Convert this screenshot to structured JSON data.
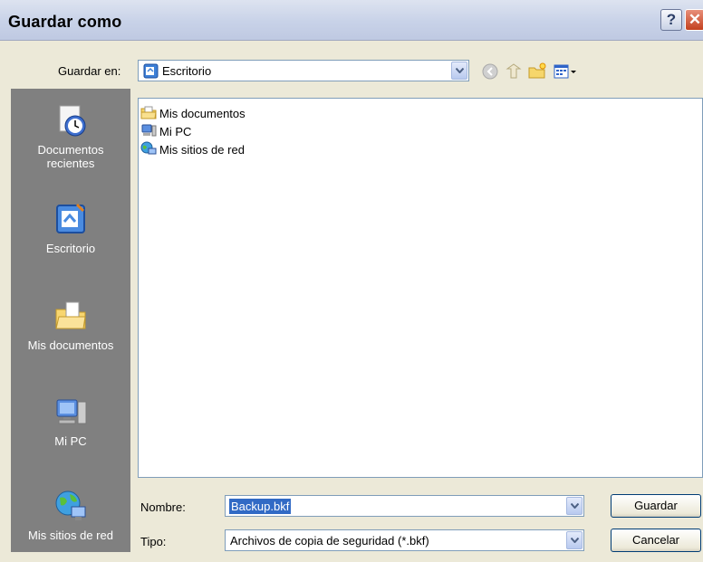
{
  "window": {
    "title": "Guardar como"
  },
  "save_in": {
    "label": "Guardar en:",
    "value": "Escritorio"
  },
  "places_bar": [
    {
      "label": "Documentos recientes"
    },
    {
      "label": "Escritorio"
    },
    {
      "label": "Mis documentos"
    },
    {
      "label": "Mi PC"
    },
    {
      "label": "Mis sitios de red"
    }
  ],
  "files": [
    {
      "name": "Mis documentos"
    },
    {
      "name": "Mi PC"
    },
    {
      "name": "Mis sitios de red"
    }
  ],
  "filename": {
    "label": "Nombre:",
    "value": "Backup.bkf"
  },
  "filetype": {
    "label": "Tipo:",
    "value": "Archivos de copia de seguridad (*.bkf)"
  },
  "buttons": {
    "save": "Guardar",
    "cancel": "Cancelar"
  }
}
